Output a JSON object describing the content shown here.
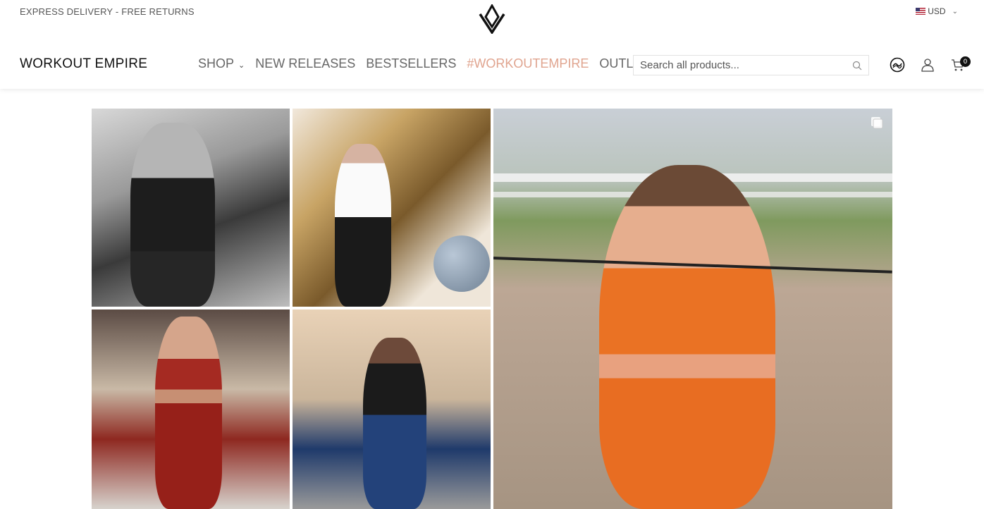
{
  "topbar": {
    "promo": "EXPRESS DELIVERY - FREE RETURNS",
    "currency": "USD"
  },
  "header": {
    "brand": "WORKOUT EMPIRE",
    "nav": [
      {
        "label": "SHOP",
        "has_dropdown": true
      },
      {
        "label": "NEW RELEASES"
      },
      {
        "label": "BESTSELLERS"
      },
      {
        "label": "#WORKOUTEMPIRE",
        "active": true
      },
      {
        "label": "OUTLET"
      }
    ],
    "search_placeholder": "Search all products...",
    "cart_count": "0"
  },
  "colors": {
    "accent": "#e0a48f",
    "text": "#222222",
    "nav_text": "#666666"
  },
  "icons": [
    "logo-mark-icon",
    "us-flag-icon",
    "chevron-down-icon",
    "search-icon",
    "sass-badge-icon",
    "user-icon",
    "cart-icon",
    "multiple-images-icon"
  ],
  "gallery": {
    "tiles": [
      {
        "id": "t1",
        "alt": "black and white mirror selfie"
      },
      {
        "id": "t2",
        "alt": "selfie by buddha painting"
      },
      {
        "id": "t3",
        "alt": "gym pose in red"
      },
      {
        "id": "t4",
        "alt": "blue leggings outdoors"
      },
      {
        "id": "t5",
        "alt": "running in orange set",
        "multi": true
      }
    ]
  }
}
